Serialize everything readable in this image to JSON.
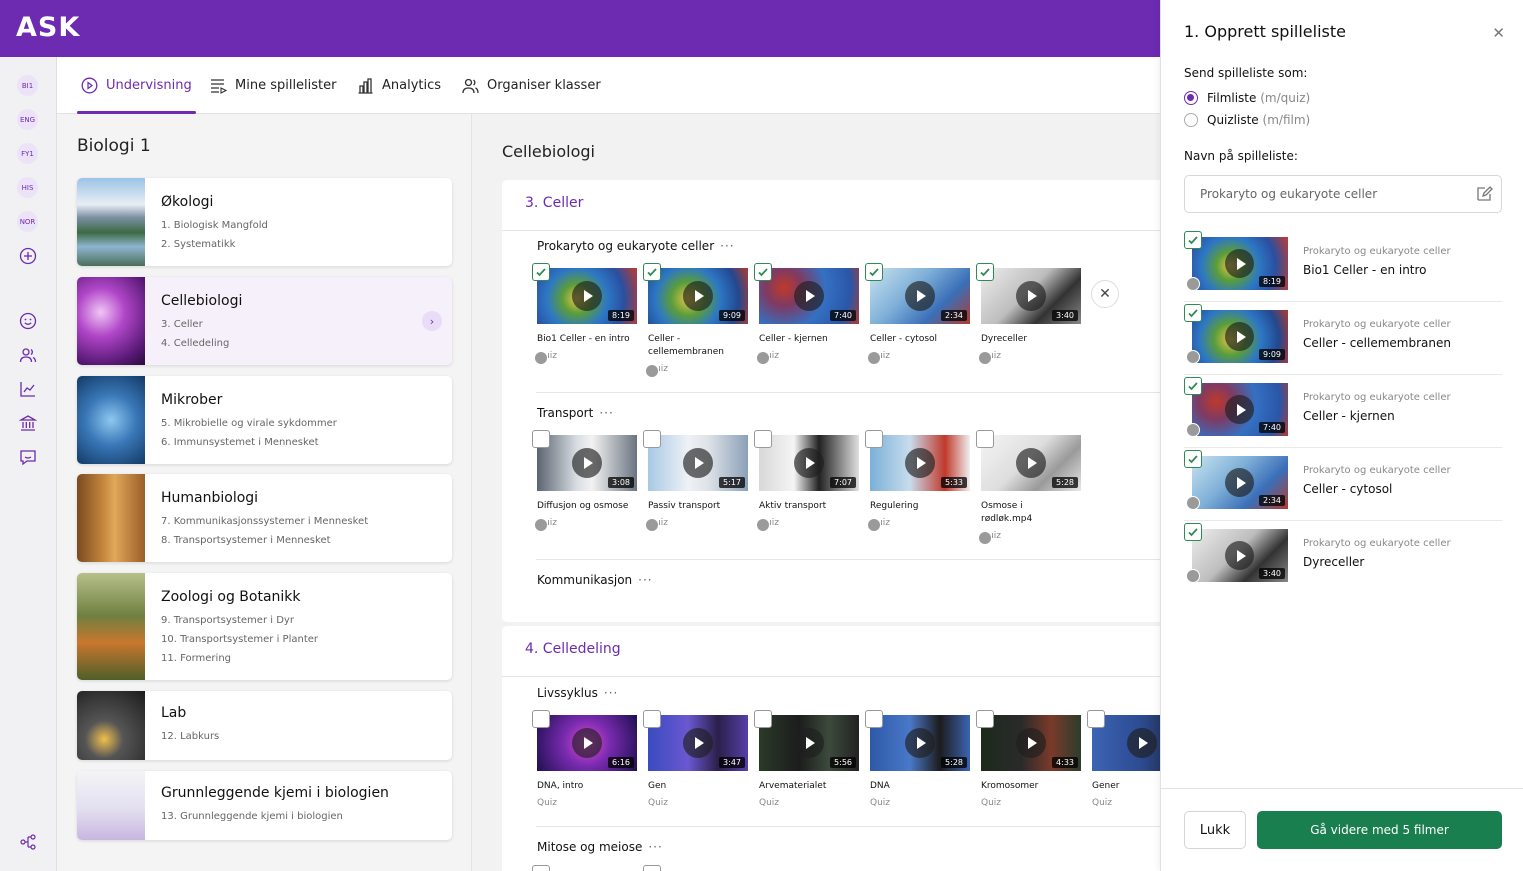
{
  "app": {
    "logo": "ASK"
  },
  "rail": {
    "badges": [
      "BI1",
      "ENG",
      "FY1",
      "HIS",
      "NOR"
    ],
    "icons": [
      "add-icon",
      "smiley-icon",
      "users-icon",
      "chart-line-icon",
      "institution-icon",
      "chat-icon",
      "sitemap-icon"
    ]
  },
  "nav": {
    "tabs": [
      {
        "label": "Undervisning",
        "icon": "play-circle-icon",
        "active": true
      },
      {
        "label": "Mine spillelister",
        "icon": "playlist-icon",
        "active": false
      },
      {
        "label": "Analytics",
        "icon": "bar-chart-icon",
        "active": false
      },
      {
        "label": "Organiser klasser",
        "icon": "users-icon",
        "active": false
      }
    ]
  },
  "subject": {
    "title": "Biologi 1",
    "cards": [
      {
        "title": "Økologi",
        "items": [
          "1. Biologisk Mangfold",
          "2. Systematikk"
        ]
      },
      {
        "title": "Cellebiologi",
        "items": [
          "3. Celler",
          "4. Celledeling"
        ],
        "selected": true
      },
      {
        "title": "Mikrober",
        "items": [
          "5. Mikrobielle og virale sykdommer",
          "6. Immunsystemet i Mennesket"
        ]
      },
      {
        "title": "Humanbiologi",
        "items": [
          "7. Kommunikasjonssystemer i Mennesket",
          "8. Transportsystemer i Mennesket"
        ]
      },
      {
        "title": "Zoologi og Botanikk",
        "items": [
          "9. Transportsystemer i Dyr",
          "10. Transportsystemer i Planter",
          "11. Formering"
        ]
      },
      {
        "title": "Lab",
        "items": [
          "12. Labkurs"
        ]
      },
      {
        "title": "Grunnleggende kjemi i biologien",
        "items": [
          "13. Grunnleggende kjemi i biologien"
        ]
      }
    ]
  },
  "center": {
    "title": "Cellebiologi",
    "sections": [
      {
        "title": "3. Celler",
        "groups": [
          {
            "title": "Prokaryto og eukaryote celler",
            "videos": [
              {
                "name": "Bio1 Celler - en intro",
                "duration": "8:19",
                "tag": "Quiz",
                "checked": true
              },
              {
                "name": "Celler - cellemembranen",
                "duration": "9:09",
                "tag": "Quiz",
                "checked": true
              },
              {
                "name": "Celler - kjernen",
                "duration": "7:40",
                "tag": "Quiz",
                "checked": true
              },
              {
                "name": "Celler - cytosol",
                "duration": "2:34",
                "tag": "Quiz",
                "checked": true
              },
              {
                "name": "Dyreceller",
                "duration": "3:40",
                "tag": "Quiz",
                "checked": true
              }
            ]
          },
          {
            "title": "Transport",
            "videos": [
              {
                "name": "Diffusjon og osmose",
                "duration": "3:08",
                "tag": "Quiz",
                "checked": false
              },
              {
                "name": "Passiv transport",
                "duration": "5:17",
                "tag": "Quiz",
                "checked": false
              },
              {
                "name": "Aktiv transport",
                "duration": "7:07",
                "tag": "Quiz",
                "checked": false
              },
              {
                "name": "Regulering",
                "duration": "5:33",
                "tag": "Quiz",
                "checked": false
              },
              {
                "name": "Osmose i rødløk.mp4",
                "duration": "5:28",
                "tag": "Quiz",
                "checked": false
              }
            ]
          },
          {
            "title": "Kommunikasjon",
            "videos": []
          }
        ]
      },
      {
        "title": "4. Celledeling",
        "groups": [
          {
            "title": "Livssyklus",
            "videos": [
              {
                "name": "DNA, intro",
                "duration": "6:16",
                "tag": "Quiz",
                "checked": false
              },
              {
                "name": "Gen",
                "duration": "3:47",
                "tag": "Quiz",
                "checked": false
              },
              {
                "name": "Arvematerialet",
                "duration": "5:56",
                "tag": "Quiz",
                "checked": false
              },
              {
                "name": "DNA",
                "duration": "5:28",
                "tag": "Quiz",
                "checked": false
              },
              {
                "name": "Kromosomer",
                "duration": "4:33",
                "tag": "Quiz",
                "checked": false
              },
              {
                "name": "Gener",
                "duration": "",
                "tag": "Quiz",
                "checked": false
              }
            ]
          },
          {
            "title": "Mitose og meiose",
            "videos": []
          }
        ]
      }
    ]
  },
  "drawer": {
    "title": "1. Opprett spilleliste",
    "send_label": "Send spilleliste som:",
    "options": [
      {
        "label": "Filmliste",
        "hint": "(m/quiz)",
        "selected": true
      },
      {
        "label": "Quizliste",
        "hint": "(m/film)",
        "selected": false
      }
    ],
    "name_label": "Navn på spilleliste:",
    "name_value": "Prokaryto og eukaryote celler",
    "items": [
      {
        "group": "Prokaryto og eukaryote celler",
        "name": "Bio1 Celler - en intro",
        "duration": "8:19"
      },
      {
        "group": "Prokaryto og eukaryote celler",
        "name": "Celler - cellemembranen",
        "duration": "9:09"
      },
      {
        "group": "Prokaryto og eukaryote celler",
        "name": "Celler - kjernen",
        "duration": "7:40"
      },
      {
        "group": "Prokaryto og eukaryote celler",
        "name": "Celler - cytosol",
        "duration": "2:34"
      },
      {
        "group": "Prokaryto og eukaryote celler",
        "name": "Dyreceller",
        "duration": "3:40"
      }
    ],
    "close_label": "Lukk",
    "continue_label": "Gå videre med 5 filmer"
  },
  "colors": {
    "brand": "#6c2bb0",
    "primary_button": "#1a7f4f",
    "check": "#2f8a55"
  }
}
